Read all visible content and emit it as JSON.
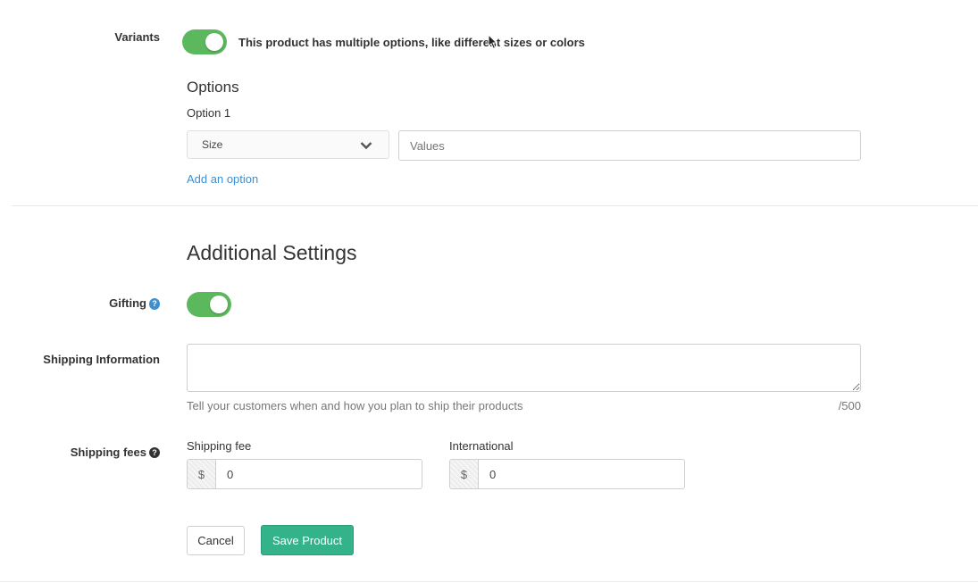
{
  "variants": {
    "label": "Variants",
    "toggle_on": true,
    "description": "This product has multiple options, like different sizes or colors"
  },
  "options": {
    "heading": "Options",
    "option_label": "Option 1",
    "select_value": "Size",
    "values_placeholder": "Values",
    "add_option_link": "Add an option"
  },
  "additional": {
    "heading": "Additional Settings",
    "gifting_label": "Gifting",
    "gifting_toggle_on": true,
    "shipping_info_label": "Shipping Information",
    "shipping_info_help": "Tell your customers when and how you plan to ship their products",
    "shipping_info_counter": "/500",
    "shipping_fees_label": "Shipping fees",
    "shipping_fee_label": "Shipping fee",
    "shipping_fee_currency": "$",
    "shipping_fee_value": "0",
    "international_label": "International",
    "international_currency": "$",
    "international_value": "0"
  },
  "actions": {
    "cancel_label": "Cancel",
    "save_label": "Save Product"
  },
  "colors": {
    "toggle_on": "#5cb85c",
    "link": "#3d8fd1",
    "save_button": "#34b38a"
  }
}
